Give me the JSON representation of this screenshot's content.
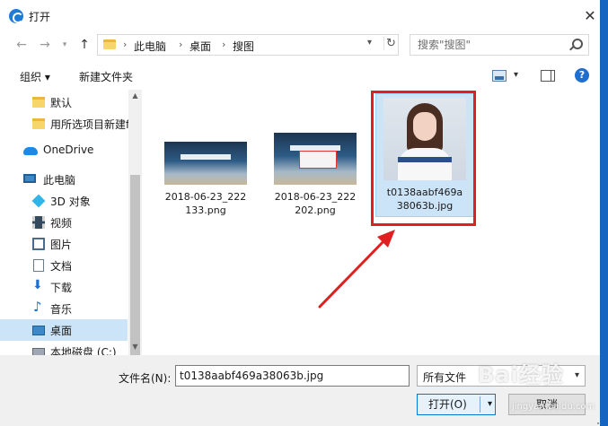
{
  "window": {
    "title": "打开"
  },
  "address": {
    "crumbs": [
      "此电脑",
      "桌面",
      "搜图"
    ],
    "search_placeholder": "搜索\"搜图\""
  },
  "toolbar": {
    "organize": "组织 ▾",
    "new_folder": "新建文件夹",
    "help": "?"
  },
  "sidebar": {
    "items": [
      {
        "label": "默认",
        "icon": "folder-icon"
      },
      {
        "label": "用所选项目新建f",
        "icon": "folder-icon"
      },
      {
        "label": "OneDrive",
        "icon": "cloud-icon"
      },
      {
        "label": "此电脑",
        "icon": "computer-icon"
      },
      {
        "label": "3D 对象",
        "icon": "cube-icon"
      },
      {
        "label": "视频",
        "icon": "video-icon"
      },
      {
        "label": "图片",
        "icon": "picture-icon"
      },
      {
        "label": "文档",
        "icon": "document-icon"
      },
      {
        "label": "下载",
        "icon": "download-icon"
      },
      {
        "label": "音乐",
        "icon": "music-icon"
      },
      {
        "label": "桌面",
        "icon": "desktop-icon",
        "selected": true
      },
      {
        "label": "本地磁盘 (C:)",
        "icon": "disk-icon"
      }
    ]
  },
  "files": [
    {
      "name": "2018-06-23_222133.png",
      "line1": "2018-06-23_222",
      "line2": "133.png"
    },
    {
      "name": "2018-06-23_222202.png",
      "line1": "2018-06-23_222",
      "line2": "202.png"
    },
    {
      "name": "t0138aabf469a38063b.jpg",
      "line1": "t0138aabf469a",
      "line2": "38063b.jpg",
      "selected": true
    }
  ],
  "footer": {
    "filename_label": "文件名(N):",
    "filename_value": "t0138aabf469a38063b.jpg",
    "filetype_value": "所有文件",
    "open_label": "打开(O)",
    "cancel_label": "取消"
  },
  "watermark": {
    "text": "Bai经验",
    "sub": "jingyan.baidu.com"
  },
  "colors": {
    "selection": "#cce4f7",
    "highlight_box": "#e02020",
    "accent": "#0078d7"
  }
}
